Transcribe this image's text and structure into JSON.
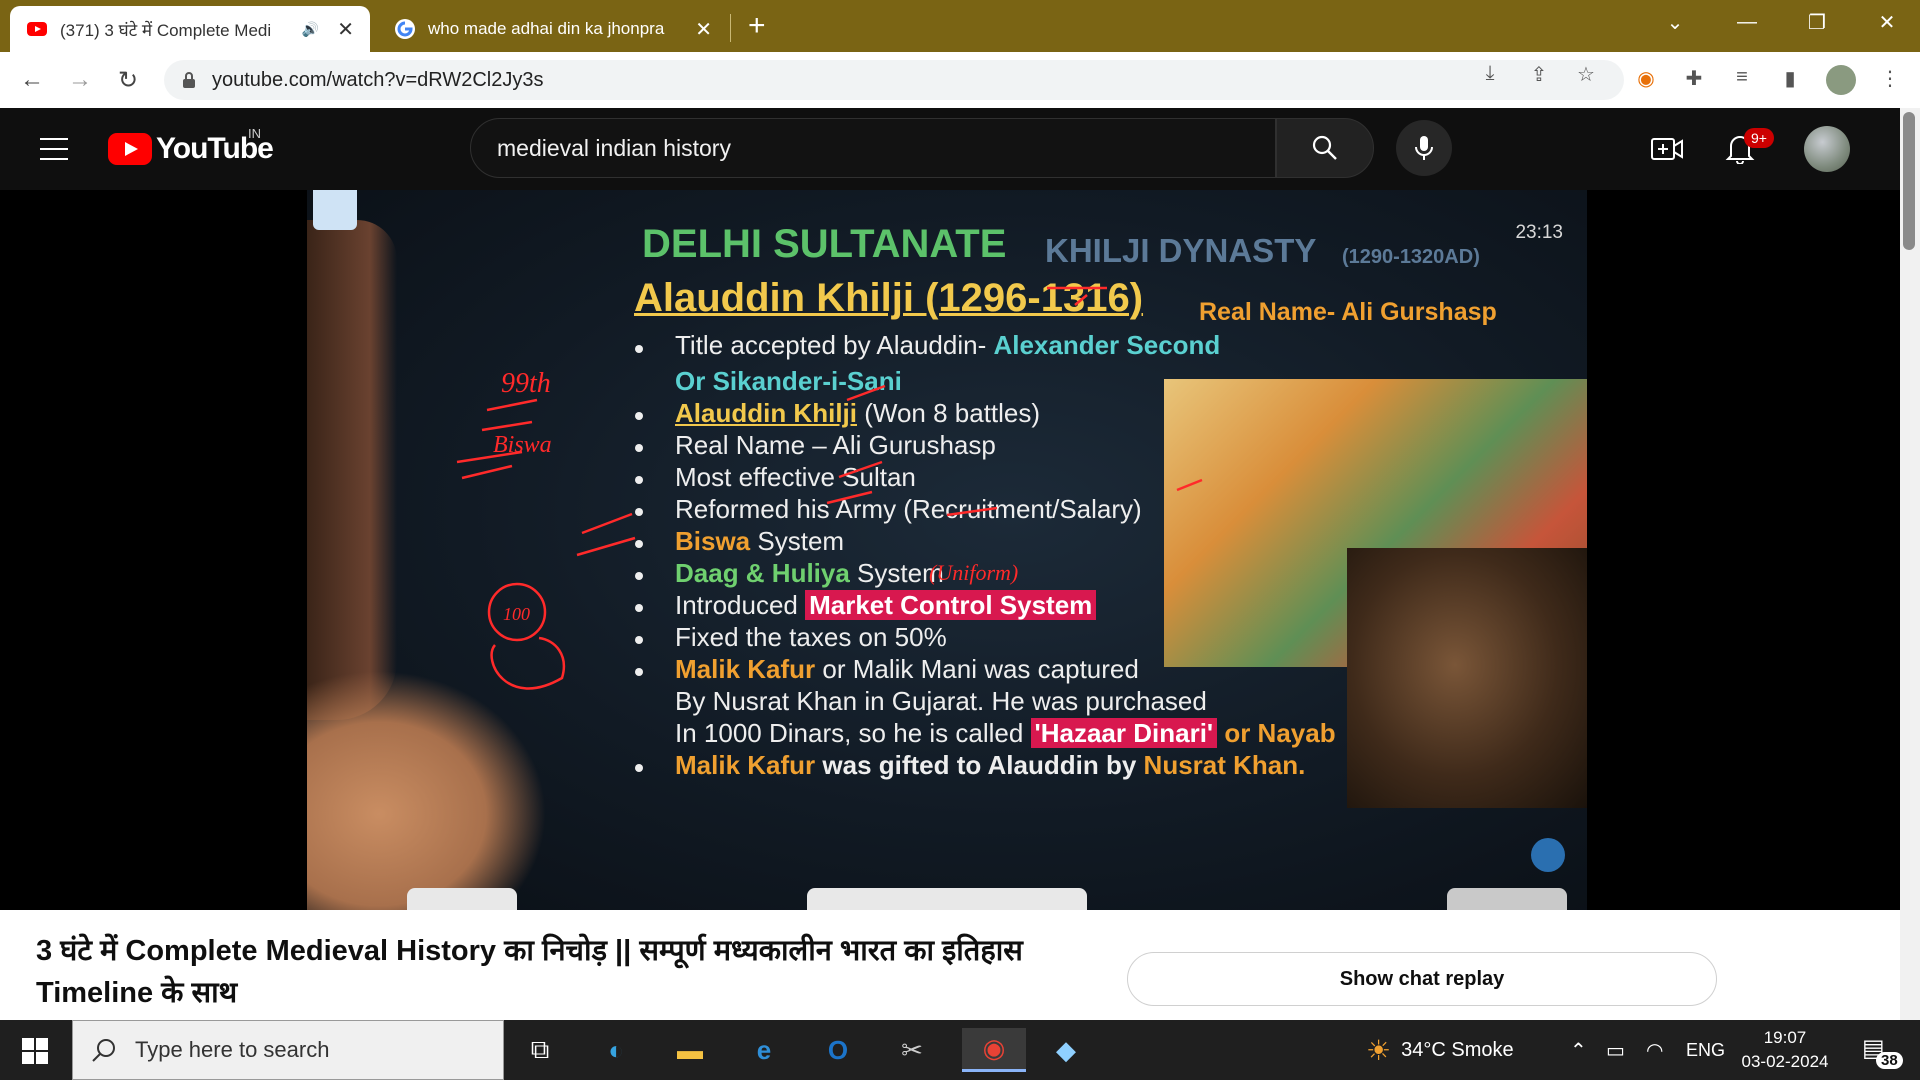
{
  "browser": {
    "tabs": [
      {
        "title": "(371) 3 घंटे में Complete Medi",
        "active": true,
        "favicon": "youtube-favicon"
      },
      {
        "title": "who made adhai din ka jhonpra",
        "active": false,
        "favicon": "google-favicon"
      }
    ],
    "url": "youtube.com/watch?v=dRW2Cl2Jy3s"
  },
  "youtube": {
    "logo_text": "YouTube",
    "country_code": "IN",
    "search_query": "medieval indian history",
    "notifications_badge": "9+"
  },
  "video": {
    "timer": "23:13",
    "heading_main": "DELHI SULTANATE",
    "heading_sub": "KHILJI DYNASTY",
    "heading_years": "(1290-1320AD)",
    "ruler": "Alauddin Khilji (1296-1316)",
    "real_name_tag": "Real Name- Ali Gurshasp",
    "bullets": [
      {
        "pre": "Title accepted by Alauddin- ",
        "hi": "Alexander Second"
      },
      {
        "pre": "",
        "hi": "Or Sikander-i-Sani"
      },
      {
        "pre": "Alauddin Khilji",
        "hi": " (Won 8 battles)"
      },
      {
        "pre": "Real Name – Ali Gurushasp",
        "hi": ""
      },
      {
        "pre": "Most effective Sultan",
        "hi": ""
      },
      {
        "pre": "Reformed his Army (Recruitment/Salary)",
        "hi": ""
      },
      {
        "pre": "Biswa",
        "hi": " System"
      },
      {
        "pre": "Daag & Huliya",
        "hi": " System"
      },
      {
        "pre": "Introduced ",
        "hi": "Market Control System"
      },
      {
        "pre": "Fixed the taxes on 50%",
        "hi": ""
      },
      {
        "pre": "Malik Kafur",
        "hi": " or Malik Mani was captured"
      },
      {
        "pre": "By Nusrat Khan in Gujarat. He was purchased",
        "hi": ""
      },
      {
        "pre": "In 1000 Dinars, so he is called ",
        "hi": "'Hazaar Dinari'",
        "post": " or Nayab"
      },
      {
        "pre": "Malik Kafur",
        "hi": " was gifted to Alauddin by ",
        "post": "Nusrat Khan."
      }
    ],
    "handwriting": [
      "99th",
      "Biswa",
      "(Uniform)",
      "100"
    ]
  },
  "page": {
    "video_title": "3 घंटे में Complete Medieval History का निचोड़ || सम्पूर्ण मध्यकालीन भारत का इतिहास Timeline के साथ",
    "chat_button": "Show chat replay"
  },
  "taskbar": {
    "search_placeholder": "Type here to search",
    "weather": "34°C  Smoke",
    "language": "ENG",
    "time": "19:07",
    "date": "03-02-2024",
    "notification_count": "38"
  }
}
